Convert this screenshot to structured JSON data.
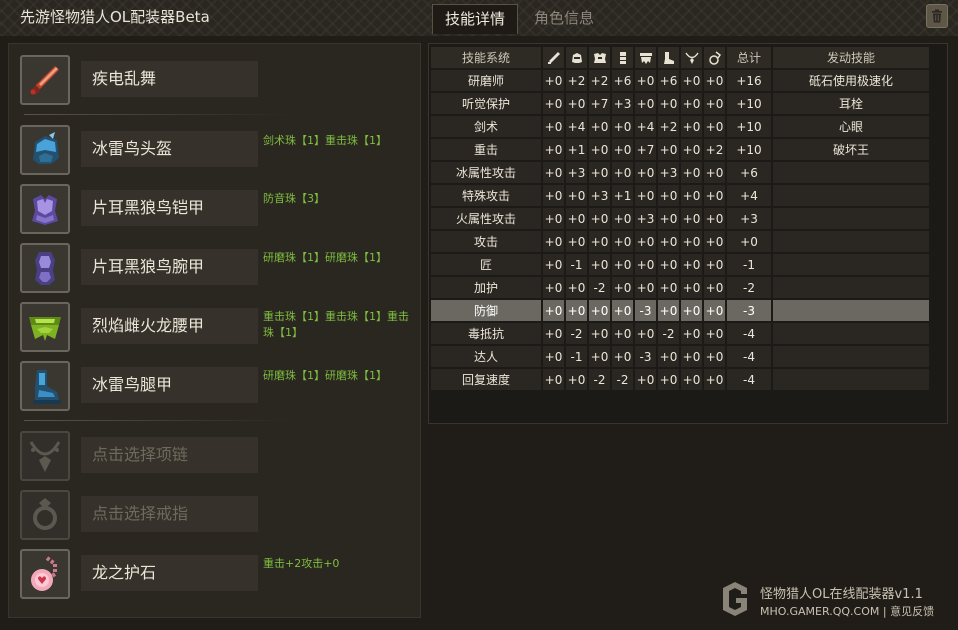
{
  "app": {
    "title": "先游怪物猎人OL配装器Beta"
  },
  "tabs": [
    {
      "label": "技能详情",
      "active": true
    },
    {
      "label": "角色信息",
      "active": false
    }
  ],
  "toolbar": {
    "trash_icon": "trash-icon"
  },
  "slots": [
    {
      "icon": "weapon-icon",
      "name": "疾电乱舞",
      "gems": "",
      "empty": false
    },
    {
      "icon": "helmet-icon",
      "name": "冰雷鸟头盔",
      "gems": "剑术珠【1】重击珠【1】",
      "empty": false
    },
    {
      "icon": "chest-icon",
      "name": "片耳黑狼鸟铠甲",
      "gems": "防音珠【3】",
      "empty": false
    },
    {
      "icon": "arm-icon",
      "name": "片耳黑狼鸟腕甲",
      "gems": "研磨珠【1】研磨珠【1】",
      "empty": false
    },
    {
      "icon": "waist-icon",
      "name": "烈焰雌火龙腰甲",
      "gems": "重击珠【1】重击珠【1】重击珠【1】",
      "empty": false
    },
    {
      "icon": "leg-icon",
      "name": "冰雷鸟腿甲",
      "gems": "研磨珠【1】研磨珠【1】",
      "empty": false
    },
    {
      "icon": "necklace-icon",
      "name": "点击选择项链",
      "gems": "",
      "empty": true
    },
    {
      "icon": "ring-icon",
      "name": "点击选择戒指",
      "gems": "",
      "empty": true
    },
    {
      "icon": "charm-icon",
      "name": "龙之护石",
      "gems": "重击+2攻击+0",
      "empty": false
    }
  ],
  "skill_table": {
    "headers": {
      "skill": "技能系统",
      "parts": [
        "weapon-icon",
        "helmet-icon",
        "chest-icon",
        "arm-icon",
        "waist-icon",
        "leg-icon",
        "necklace-icon",
        "charm-icon"
      ],
      "total": "总计",
      "active": "发动技能"
    },
    "rows": [
      {
        "skill": "研磨师",
        "values": [
          "+0",
          "+2",
          "+2",
          "+6",
          "+0",
          "+6",
          "+0",
          "+0"
        ],
        "total": "+16",
        "active": "砥石使用极速化"
      },
      {
        "skill": "听觉保护",
        "values": [
          "+0",
          "+0",
          "+7",
          "+3",
          "+0",
          "+0",
          "+0",
          "+0"
        ],
        "total": "+10",
        "active": "耳栓"
      },
      {
        "skill": "剑术",
        "values": [
          "+0",
          "+4",
          "+0",
          "+0",
          "+4",
          "+2",
          "+0",
          "+0"
        ],
        "total": "+10",
        "active": "心眼"
      },
      {
        "skill": "重击",
        "values": [
          "+0",
          "+1",
          "+0",
          "+0",
          "+7",
          "+0",
          "+0",
          "+2"
        ],
        "total": "+10",
        "active": "破坏王"
      },
      {
        "skill": "冰属性攻击",
        "values": [
          "+0",
          "+3",
          "+0",
          "+0",
          "+0",
          "+3",
          "+0",
          "+0"
        ],
        "total": "+6",
        "active": ""
      },
      {
        "skill": "特殊攻击",
        "values": [
          "+0",
          "+0",
          "+3",
          "+1",
          "+0",
          "+0",
          "+0",
          "+0"
        ],
        "total": "+4",
        "active": ""
      },
      {
        "skill": "火属性攻击",
        "values": [
          "+0",
          "+0",
          "+0",
          "+0",
          "+3",
          "+0",
          "+0",
          "+0"
        ],
        "total": "+3",
        "active": ""
      },
      {
        "skill": "攻击",
        "values": [
          "+0",
          "+0",
          "+0",
          "+0",
          "+0",
          "+0",
          "+0",
          "+0"
        ],
        "total": "+0",
        "active": ""
      },
      {
        "skill": "匠",
        "values": [
          "+0",
          "-1",
          "+0",
          "+0",
          "+0",
          "+0",
          "+0",
          "+0"
        ],
        "total": "-1",
        "active": ""
      },
      {
        "skill": "加护",
        "values": [
          "+0",
          "+0",
          "-2",
          "+0",
          "+0",
          "+0",
          "+0",
          "+0"
        ],
        "total": "-2",
        "active": ""
      },
      {
        "skill": "防御",
        "values": [
          "+0",
          "+0",
          "+0",
          "+0",
          "-3",
          "+0",
          "+0",
          "+0"
        ],
        "total": "-3",
        "active": "",
        "highlight": true
      },
      {
        "skill": "毒抵抗",
        "values": [
          "+0",
          "-2",
          "+0",
          "+0",
          "+0",
          "-2",
          "+0",
          "+0"
        ],
        "total": "-4",
        "active": ""
      },
      {
        "skill": "达人",
        "values": [
          "+0",
          "-1",
          "+0",
          "+0",
          "-3",
          "+0",
          "+0",
          "+0"
        ],
        "total": "-4",
        "active": ""
      },
      {
        "skill": "回复速度",
        "values": [
          "+0",
          "+0",
          "-2",
          "-2",
          "+0",
          "+0",
          "+0",
          "+0"
        ],
        "total": "-4",
        "active": ""
      }
    ]
  },
  "footer": {
    "title": "怪物猎人OL在线配装器v1.1",
    "url": "MHO.GAMER.QQ.COM",
    "separator": "|",
    "feedback": "意见反馈"
  }
}
